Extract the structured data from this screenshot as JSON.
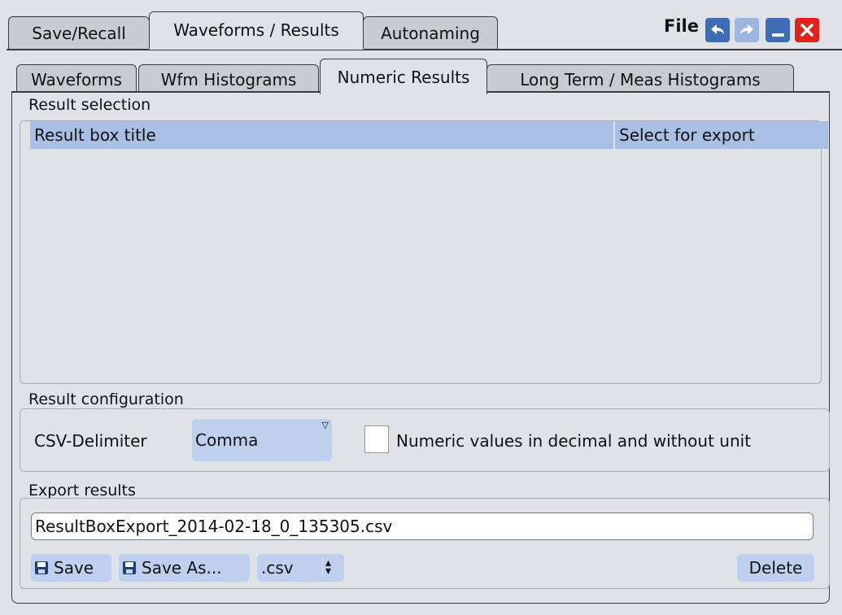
{
  "header": {
    "title": "File",
    "tabs": [
      {
        "label": "Save/Recall"
      },
      {
        "label": "Waveforms / Results"
      },
      {
        "label": "Autonaming"
      }
    ]
  },
  "subtabs": [
    {
      "label": "Waveforms"
    },
    {
      "label": "Wfm Histograms"
    },
    {
      "label": "Numeric Results"
    },
    {
      "label": "Long Term / Meas Histograms"
    }
  ],
  "result_selection": {
    "label": "Result selection",
    "columns": [
      "Result box title",
      "Select for export"
    ]
  },
  "result_configuration": {
    "label": "Result configuration",
    "delimiter_label": "CSV-Delimiter",
    "delimiter_value": "Comma",
    "numeric_checkbox_label": "Numeric values in decimal and without unit",
    "numeric_checked": false
  },
  "export_results": {
    "label": "Export results",
    "filename": "ResultBoxExport_2014-02-18_0_135305.csv",
    "save_label": "Save",
    "save_as_label": "Save As...",
    "format_value": ".csv",
    "delete_label": "Delete"
  },
  "icons": {
    "undo": "undo-icon",
    "redo": "redo-icon",
    "minimize": "minimize-icon",
    "close": "close-icon",
    "save": "floppy-icon"
  },
  "colors": {
    "accent": "#bed0ee",
    "header_row": "#a9bfe4",
    "close": "#e0221b",
    "toolbar_button": "#3d6db5"
  }
}
